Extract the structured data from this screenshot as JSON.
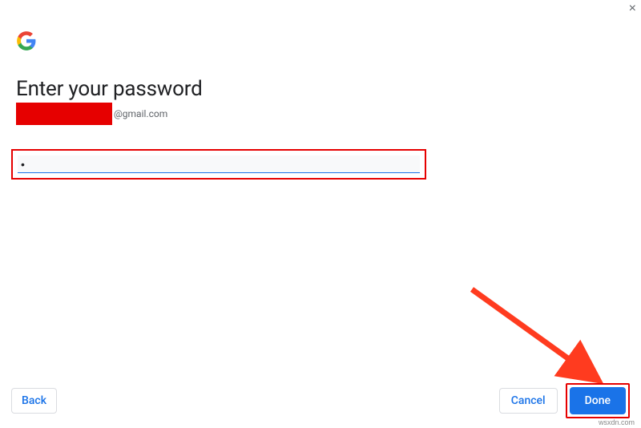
{
  "close_label": "×",
  "heading": "Enter your password",
  "email_domain": "@gmail.com",
  "password_value": "•",
  "buttons": {
    "back": "Back",
    "cancel": "Cancel",
    "done": "Done"
  },
  "watermark": "wsxdn.com"
}
